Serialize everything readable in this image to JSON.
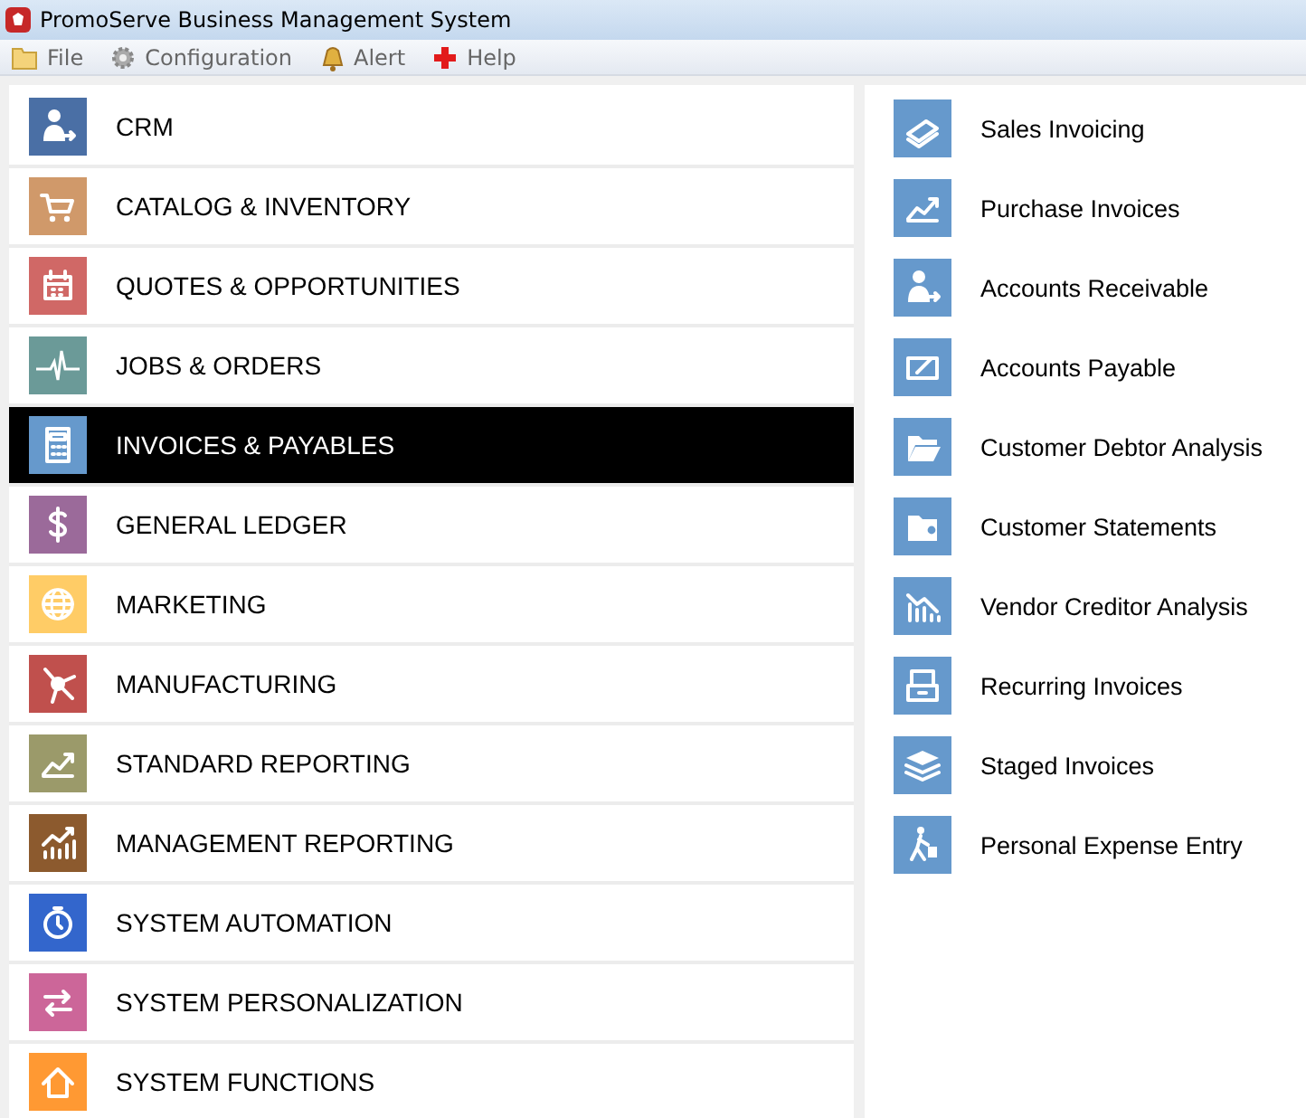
{
  "window": {
    "title": "PromoServe Business Management System"
  },
  "menu": [
    "File",
    "Configuration",
    "Alert",
    "Help"
  ],
  "modules": [
    {
      "label": "CRM",
      "color": "#4a6fa5",
      "selected": false
    },
    {
      "label": "CATALOG & INVENTORY",
      "color": "#d0996a",
      "selected": false
    },
    {
      "label": "QUOTES & OPPORTUNITIES",
      "color": "#d06866",
      "selected": false
    },
    {
      "label": "JOBS & ORDERS",
      "color": "#6b9a98",
      "selected": false
    },
    {
      "label": "INVOICES & PAYABLES",
      "color": "#6699cc",
      "selected": true
    },
    {
      "label": "GENERAL LEDGER",
      "color": "#9b6a9a",
      "selected": false
    },
    {
      "label": "MARKETING",
      "color": "#ffcc66",
      "selected": false
    },
    {
      "label": "MANUFACTURING",
      "color": "#c0504d",
      "selected": false
    },
    {
      "label": "STANDARD REPORTING",
      "color": "#9b9a6a",
      "selected": false
    },
    {
      "label": "MANAGEMENT REPORTING",
      "color": "#8c5a2e",
      "selected": false
    },
    {
      "label": "SYSTEM AUTOMATION",
      "color": "#3366cc",
      "selected": false
    },
    {
      "label": "SYSTEM PERSONALIZATION",
      "color": "#cc6699",
      "selected": false
    },
    {
      "label": "SYSTEM FUNCTIONS",
      "color": "#ff9933",
      "selected": false
    }
  ],
  "functions": [
    "Sales Invoicing",
    "Purchase Invoices",
    "Accounts Receivable",
    "Accounts Payable",
    "Customer Debtor Analysis",
    "Customer Statements",
    "Vendor Creditor Analysis",
    "Recurring Invoices",
    "Staged Invoices",
    "Personal Expense Entry"
  ]
}
